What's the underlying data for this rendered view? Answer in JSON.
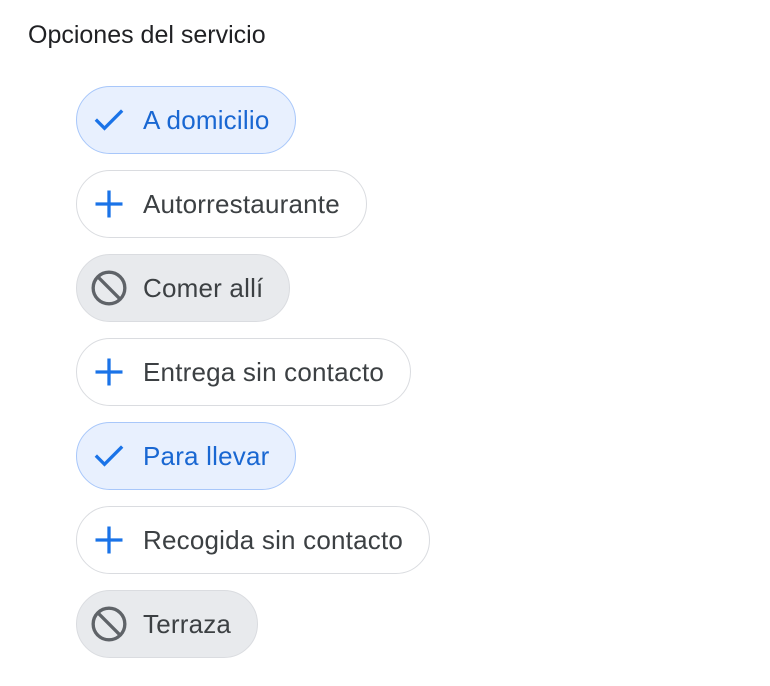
{
  "section": {
    "title": "Opciones del servicio"
  },
  "colors": {
    "selected_bg": "#e8f0fe",
    "selected_border": "#a8c7fa",
    "accent_blue": "#1a73e8",
    "unavailable_bg": "#e8eaed",
    "unavailable_icon": "#5f6368"
  },
  "options": [
    {
      "label": "A domicilio",
      "state": "yes",
      "icon": "check-icon"
    },
    {
      "label": "Autorrestaurante",
      "state": "add",
      "icon": "plus-icon"
    },
    {
      "label": "Comer allí",
      "state": "no",
      "icon": "block-icon"
    },
    {
      "label": "Entrega sin contacto",
      "state": "add",
      "icon": "plus-icon"
    },
    {
      "label": "Para llevar",
      "state": "yes",
      "icon": "check-icon"
    },
    {
      "label": "Recogida sin contacto",
      "state": "add",
      "icon": "plus-icon"
    },
    {
      "label": "Terraza",
      "state": "no",
      "icon": "block-icon"
    }
  ]
}
